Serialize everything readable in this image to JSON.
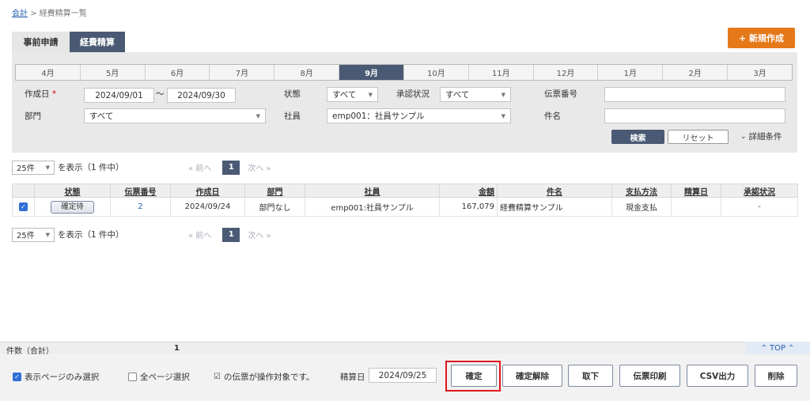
{
  "breadcrumb": {
    "root": "会計",
    "sep": ">",
    "current": "経費精算一覧"
  },
  "tabs": [
    {
      "label": "事前申請"
    },
    {
      "label": "経費精算"
    }
  ],
  "new_button": "+ 新規作成",
  "months": [
    "4月",
    "5月",
    "6月",
    "7月",
    "8月",
    "9月",
    "10月",
    "11月",
    "12月",
    "1月",
    "2月",
    "3月"
  ],
  "active_month": "9月",
  "filters": {
    "created_label": "作成日",
    "required_mark": "*",
    "date_from": "2024/09/01",
    "tilde": "〜",
    "date_to": "2024/09/30",
    "status_label": "状態",
    "status_value": "すべて",
    "approval_label": "承認状況",
    "approval_value": "すべて",
    "slip_label": "伝票番号",
    "slip_value": "",
    "dept_label": "部門",
    "dept_value": "すべて",
    "employee_label": "社員",
    "employee_value": "emp001：社員サンプル",
    "subject_label": "件名",
    "subject_value": "",
    "search_button": "検索",
    "reset_button": "リセット",
    "detail_toggle": "詳細条件"
  },
  "pagination": {
    "per_page": "25件",
    "summary": "を表示（1 件中）",
    "prev": "« 前へ",
    "current": "1",
    "next": "次へ »"
  },
  "table": {
    "headers": [
      "状態",
      "伝票番号",
      "作成日",
      "部門",
      "社員",
      "金額",
      "件名",
      "支払方法",
      "精算日",
      "承認状況"
    ],
    "rows": [
      {
        "checked": true,
        "status": "確定待",
        "slip_no": "2",
        "created": "2024/09/24",
        "dept": "部門なし",
        "employee": "emp001:社員サンプル",
        "amount": "167,079",
        "subject": "経費精算サンプル",
        "payment": "現金支払",
        "settle_date": "",
        "approval": "-"
      }
    ]
  },
  "summary": {
    "label": "件数（合計）",
    "count": "1",
    "top_link": "TOP"
  },
  "bottom": {
    "page_only": "表示ページのみ選択",
    "all_pages": "全ページ選択",
    "operation_note": "の伝票が操作対象です。",
    "settle_label": "精算日",
    "settle_value": "2024/09/25",
    "buttons": {
      "confirm": "確定",
      "unconfirm": "確定解除",
      "withdraw": "取下",
      "print": "伝票印刷",
      "csv": "CSV出力",
      "delete": "削除"
    }
  },
  "colors": {
    "accent": "#4a5a74",
    "new_button": "#e57819",
    "highlight": "#e0161d"
  }
}
